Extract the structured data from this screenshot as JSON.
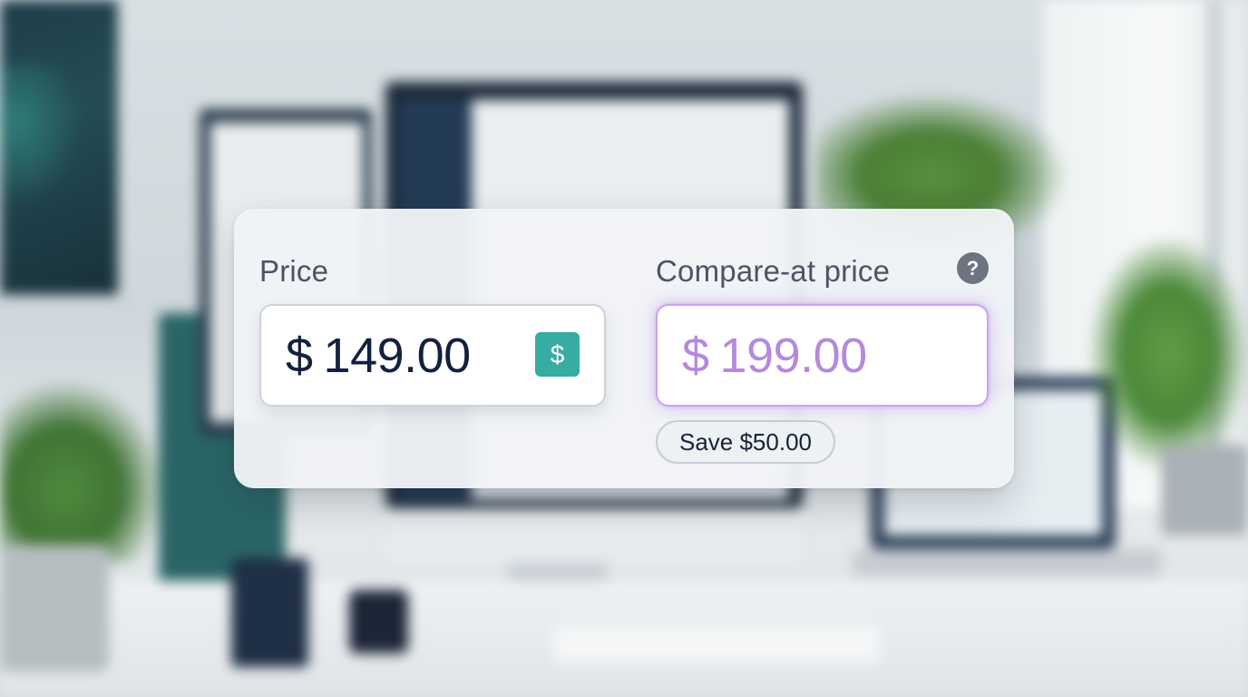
{
  "price_field": {
    "label": "Price",
    "currency_symbol": "$",
    "value": "149.00",
    "icon": "dollar-icon",
    "icon_glyph": "$"
  },
  "compare_field": {
    "label": "Compare-at price",
    "currency_symbol": "$",
    "value": "199.00",
    "help_icon": "question-icon",
    "help_glyph": "?"
  },
  "savings_badge": {
    "text": "Save $50.00"
  },
  "colors": {
    "price_text": "#13213d",
    "compare_text": "#b48add",
    "compare_glow": "#c8a6ec",
    "dollar_icon_bg": "#37aca2",
    "help_icon_bg": "#6b7480"
  }
}
